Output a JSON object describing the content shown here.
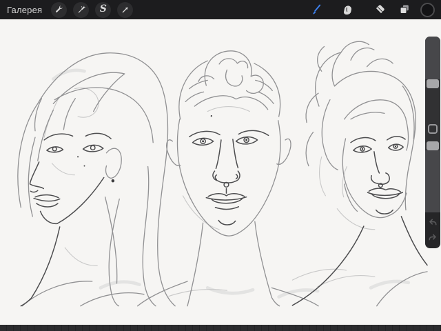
{
  "toolbar": {
    "gallery_label": "Галерея",
    "left_tools": [
      {
        "id": "actions",
        "icon": "wrench-icon"
      },
      {
        "id": "adjustments",
        "icon": "magic-wand-icon"
      },
      {
        "id": "selection",
        "icon": "s-curve-icon",
        "glyph": "S"
      },
      {
        "id": "transform",
        "icon": "arrow-cursor-icon"
      }
    ],
    "right_tools": [
      {
        "id": "paint",
        "icon": "paintbrush-icon",
        "active": true
      },
      {
        "id": "smudge",
        "icon": "smudge-finger-icon"
      },
      {
        "id": "erase",
        "icon": "eraser-icon"
      },
      {
        "id": "layers",
        "icon": "layers-icon"
      },
      {
        "id": "color",
        "icon": "color-swatch",
        "current_color": "#131315"
      }
    ],
    "accent_color": "#3e82f0"
  },
  "sidebar": {
    "sliders": [
      {
        "id": "brush-size"
      },
      {
        "id": "opacity"
      }
    ],
    "modify_button": true,
    "history": [
      "undo",
      "redo"
    ]
  },
  "canvas": {
    "content": "pencil sketch of three face studies: woman in three-quarter view with long wavy hair and stud earring, man facing forward with curled top knot and septum ring, woman in three-quarter view with messy bun and nose ring"
  },
  "colors": {
    "topbar_bg": "#1c1c1e",
    "canvas_bg": "#f6f5f3",
    "sidebar_bg": "#313133",
    "bottombar_bg": "#2b2b2d"
  }
}
